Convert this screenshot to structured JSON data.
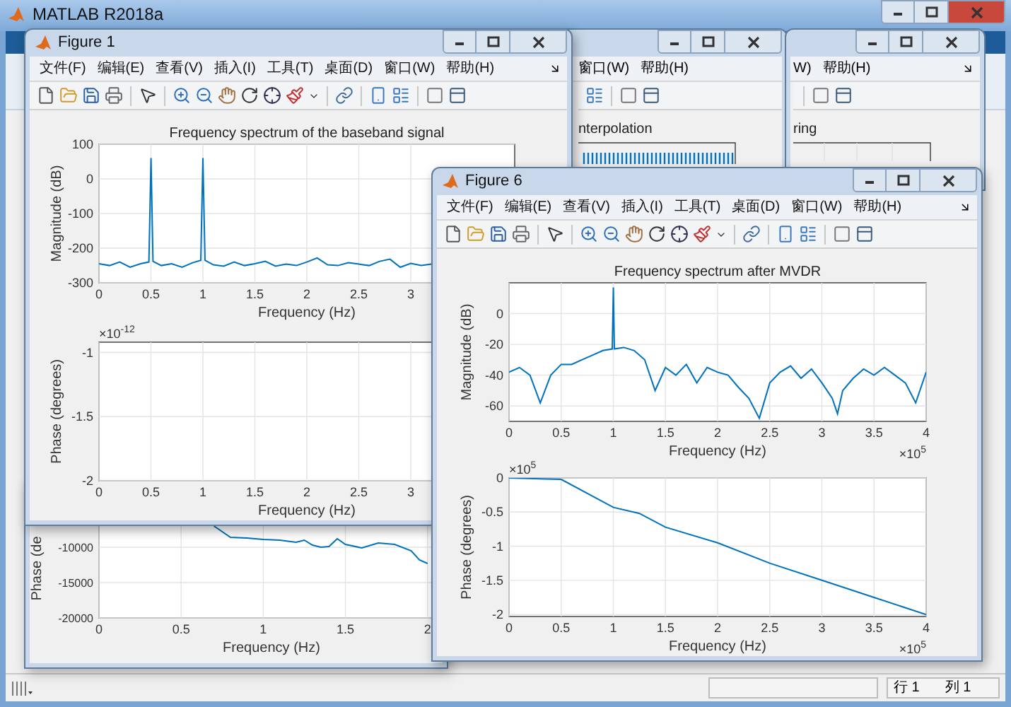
{
  "window": {
    "title": "MATLAB R2018a"
  },
  "background_windows": [
    {
      "kind": "stem",
      "menu": [
        "窗口(W)",
        "帮助(H)"
      ],
      "plot_title": "nterpolation"
    },
    {
      "kind": "grid",
      "menu": [
        "W)",
        "帮助(H)"
      ],
      "plot_title": "ring"
    }
  ],
  "hidden_figure": {
    "axes": {
      "chart_data": {
        "type": "line",
        "xlabel": "Frequency (Hz)",
        "ylabel": "Phase (de",
        "x": [
          0.7,
          0.8,
          0.9,
          1.0,
          1.1,
          1.2,
          1.25,
          1.3,
          1.35,
          1.4,
          1.45,
          1.5,
          1.6,
          1.7,
          1.8,
          1.9,
          1.95,
          2.0
        ],
        "series": [
          {
            "color": "#0072bd",
            "values": [
              -7000,
              -8600,
              -8700,
              -8900,
              -9000,
              -9300,
              -9000,
              -9700,
              -10000,
              -9900,
              -8800,
              -9600,
              -10100,
              -9400,
              -9600,
              -10500,
              -11800,
              -12300
            ]
          }
        ],
        "grid": true,
        "xlim": [
          0,
          2.1
        ],
        "ylim": [
          -20000,
          -6000
        ],
        "xticks": [
          0,
          0.5,
          1,
          1.5,
          2
        ],
        "yticks": [
          -20000,
          -15000,
          -10000
        ]
      }
    }
  },
  "figures": [
    {
      "title": "Figure 1",
      "menu": [
        "文件(F)",
        "编辑(E)",
        "查看(V)",
        "插入(I)",
        "工具(T)",
        "桌面(D)",
        "窗口(W)",
        "帮助(H)"
      ],
      "axes": [
        {
          "chart_data": {
            "type": "line",
            "title": "Frequency spectrum of the baseband signal",
            "xlabel": "Frequency (Hz)",
            "ylabel": "Magnitude (dB)",
            "x": [
              0,
              0.1,
              0.2,
              0.3,
              0.4,
              0.48,
              0.5,
              0.52,
              0.6,
              0.7,
              0.8,
              0.9,
              0.98,
              1,
              1.02,
              1.1,
              1.2,
              1.3,
              1.4,
              1.5,
              1.6,
              1.7,
              1.8,
              1.9,
              2,
              2.1,
              2.2,
              2.3,
              2.4,
              2.5,
              2.6,
              2.7,
              2.8,
              2.9,
              3,
              3.1,
              3.2
            ],
            "series": [
              {
                "color": "#0072bd",
                "values": [
                  -245,
                  -250,
                  -240,
                  -255,
                  -245,
                  -240,
                  60,
                  -238,
                  -250,
                  -245,
                  -255,
                  -242,
                  -235,
                  60,
                  -235,
                  -248,
                  -252,
                  -240,
                  -250,
                  -245,
                  -238,
                  -252,
                  -246,
                  -250,
                  -240,
                  -228,
                  -248,
                  -250,
                  -242,
                  -246,
                  -250,
                  -238,
                  -232,
                  -255,
                  -244,
                  -250,
                  -246
                ]
              }
            ],
            "grid": true,
            "xlim": [
              0,
              4
            ],
            "ylim": [
              -300,
              100
            ],
            "xticks": [
              0,
              0.5,
              1,
              1.5,
              2,
              2.5,
              3
            ],
            "yticks": [
              -300,
              -200,
              -100,
              0,
              100
            ]
          }
        },
        {
          "y_exponent": {
            "base": "×10",
            "power": "-12"
          },
          "chart_data": {
            "type": "line",
            "xlabel": "Frequency (Hz)",
            "ylabel": "Phase (degrees)",
            "grid": true,
            "xlim": [
              0,
              4
            ],
            "ylim": [
              -2,
              -0.92
            ],
            "xticks": [
              0,
              0.5,
              1,
              1.5,
              2,
              2.5,
              3
            ],
            "yticks": [
              -2,
              -1.5,
              -1
            ]
          }
        }
      ]
    },
    {
      "title": "Figure 6",
      "menu": [
        "文件(F)",
        "编辑(E)",
        "查看(V)",
        "插入(I)",
        "工具(T)",
        "桌面(D)",
        "窗口(W)",
        "帮助(H)"
      ],
      "axes": [
        {
          "x_exponent": {
            "base": "×10",
            "power": "5"
          },
          "chart_data": {
            "type": "line",
            "title": "Frequency spectrum after MVDR",
            "xlabel": "Frequency (Hz)",
            "ylabel": "Magnitude (dB)",
            "x": [
              0,
              0.1,
              0.2,
              0.3,
              0.4,
              0.5,
              0.6,
              0.7,
              0.8,
              0.9,
              0.99,
              1,
              1.01,
              1.1,
              1.2,
              1.3,
              1.4,
              1.5,
              1.6,
              1.7,
              1.8,
              1.9,
              2,
              2.1,
              2.2,
              2.3,
              2.4,
              2.5,
              2.6,
              2.7,
              2.8,
              2.9,
              3,
              3.1,
              3.15,
              3.2,
              3.3,
              3.4,
              3.5,
              3.6,
              3.7,
              3.8,
              3.9,
              4
            ],
            "series": [
              {
                "color": "#0072bd",
                "values": [
                  -38,
                  -35,
                  -40,
                  -58,
                  -40,
                  -33,
                  -33,
                  -30,
                  -27,
                  -24,
                  -23,
                  17,
                  -23,
                  -22,
                  -24,
                  -30,
                  -50,
                  -35,
                  -40,
                  -33,
                  -45,
                  -35,
                  -38,
                  -40,
                  -48,
                  -55,
                  -68,
                  -45,
                  -38,
                  -34,
                  -42,
                  -36,
                  -45,
                  -55,
                  -65,
                  -50,
                  -42,
                  -36,
                  -40,
                  -35,
                  -40,
                  -45,
                  -58,
                  -38
                ]
              }
            ],
            "grid": true,
            "xlim": [
              0,
              4
            ],
            "ylim": [
              -70,
              20
            ],
            "xticks": [
              0,
              0.5,
              1,
              1.5,
              2,
              2.5,
              3,
              3.5,
              4
            ],
            "yticks": [
              -60,
              -40,
              -20,
              0
            ]
          }
        },
        {
          "y_exponent": {
            "base": "×10",
            "power": "5"
          },
          "x_exponent": {
            "base": "×10",
            "power": "5"
          },
          "chart_data": {
            "type": "line",
            "xlabel": "Frequency (Hz)",
            "ylabel": "Phase (degrees)",
            "x": [
              0,
              0.5,
              1,
              1.25,
              1.5,
              2,
              2.5,
              3,
              3.5,
              4
            ],
            "series": [
              {
                "color": "#0072bd",
                "values": [
                  0,
                  -0.02,
                  -0.43,
                  -0.52,
                  -0.72,
                  -0.95,
                  -1.25,
                  -1.5,
                  -1.75,
                  -2.0
                ]
              }
            ],
            "grid": true,
            "xlim": [
              0,
              4
            ],
            "ylim": [
              -2.03,
              0
            ],
            "xticks": [
              0,
              0.5,
              1,
              1.5,
              2,
              2.5,
              3,
              3.5,
              4
            ],
            "yticks": [
              -2,
              -1.5,
              -1,
              -0.5,
              0
            ]
          }
        }
      ]
    }
  ],
  "status_bar": {
    "row": "行 1",
    "column": "列 1"
  }
}
